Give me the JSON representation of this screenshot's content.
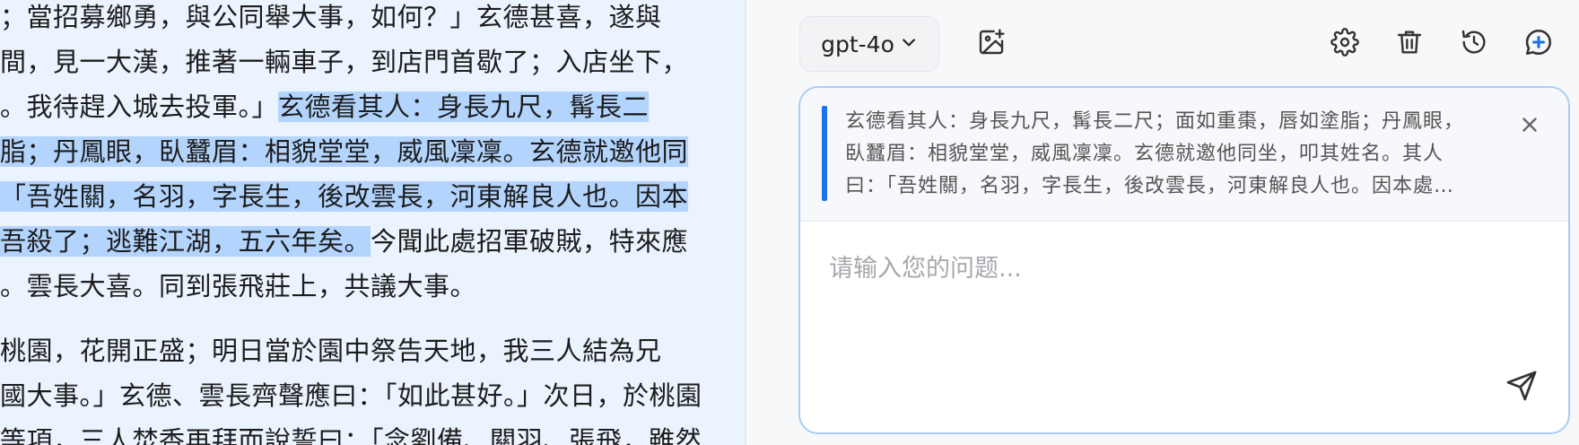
{
  "reader": {
    "lines": [
      {
        "pre": "；當招募鄉勇，與公同舉大事，如何？」玄德甚喜，遂與",
        "hl": "",
        "post": ""
      },
      {
        "pre": "間，見一大漢，推著一輛車子，到店門首歇了；入店坐下，",
        "hl": "",
        "post": ""
      },
      {
        "pre": "。我待趕入城去投軍。」",
        "hl": "玄德看其人：身長九尺，髯長二",
        "post": ""
      },
      {
        "pre": "",
        "hl": "脂；丹鳳眼，臥蠶眉：相貌堂堂，威風凜凜。玄德就邀他同",
        "post": ""
      },
      {
        "pre": "",
        "hl": "「吾姓關，名羽，字長生，後改雲長，河東解良人也。因本",
        "post": ""
      },
      {
        "pre": "",
        "hl": "吾殺了；逃難江湖，五六年矣。",
        "post": "今聞此處招軍破賊，特來應"
      },
      {
        "pre": "。雲長大喜。同到張飛莊上，共議大事。",
        "hl": "",
        "post": ""
      },
      {
        "pre": "桃園，花開正盛；明日當於園中祭告天地，我三人結為兄",
        "hl": "",
        "post": ""
      },
      {
        "pre": "國大事。」玄德、雲長齊聲應曰：「如此甚好。」次日，於桃園",
        "hl": "",
        "post": ""
      },
      {
        "pre": "等項，三人焚香再拜而說誓曰：「念劉備、關羽、張飛，雖然",
        "hl": "",
        "post": ""
      }
    ]
  },
  "toolbar": {
    "model_label": "gpt-4o",
    "icons": [
      "chevron-down-icon",
      "image-upload-icon",
      "settings-icon",
      "trash-icon",
      "history-icon",
      "new-chat-icon"
    ]
  },
  "composer": {
    "quote_text": "玄德看其人：身長九尺，髯長二尺；面如重棗，唇如塗脂；丹鳳眼，臥蠶眉：相貌堂堂，威風凜凜。玄德就邀他同坐，叩其姓名。其人曰：「吾姓關，名羽，字長生，後改雲長，河東解良人也。因本處勢豪倚勢凌人，被吾殺了；逃難江湖，五六年矣。",
    "placeholder": "请输入您的问题..."
  },
  "colors": {
    "accent": "#1a73e8",
    "highlight": "#b3d4fd",
    "reader_bg": "#eaf3fe"
  }
}
